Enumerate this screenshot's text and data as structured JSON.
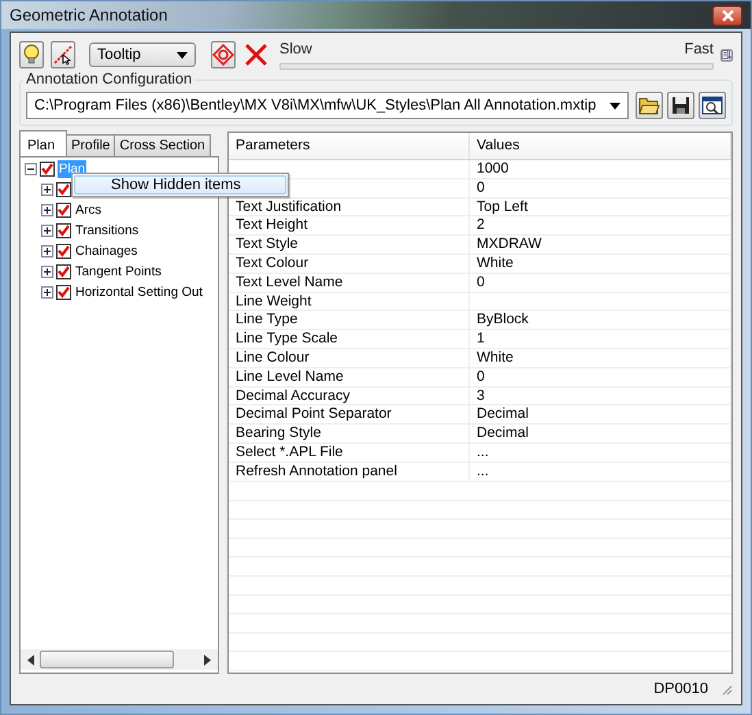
{
  "window": {
    "title": "Geometric Annotation"
  },
  "toolbar": {
    "mode_dropdown": {
      "value": "Tooltip"
    },
    "speed": {
      "min_label": "Slow",
      "max_label": "Fast"
    }
  },
  "configuration": {
    "label": "Annotation Configuration",
    "file": "C:\\Program Files (x86)\\Bentley\\MX V8i\\MX\\mfw\\UK_Styles\\Plan All Annotation.mxtip"
  },
  "tabs": [
    {
      "label": "Plan",
      "selected": true
    },
    {
      "label": "Profile",
      "selected": false
    },
    {
      "label": "Cross Section",
      "selected": false
    }
  ],
  "tree": [
    {
      "label": "Plan",
      "checked": true,
      "expanded": true,
      "selected": true,
      "children": [
        {
          "checked": true,
          "expanded": false,
          "selected": false
        },
        {
          "label": "Arcs",
          "checked": true,
          "expanded": false,
          "selected": false
        },
        {
          "label": "Transitions",
          "checked": true,
          "expanded": false,
          "selected": false
        },
        {
          "label": "Chainages",
          "checked": true,
          "expanded": false,
          "selected": false
        },
        {
          "label": "Tangent Points",
          "checked": true,
          "expanded": false,
          "selected": false
        },
        {
          "label": "Horizontal Setting Out",
          "checked": true,
          "expanded": false,
          "selected": false
        }
      ]
    }
  ],
  "context_menu": {
    "items": [
      "Show Hidden items"
    ]
  },
  "table": {
    "columns": [
      "Parameters",
      "Values"
    ],
    "rows": [
      {
        "value": "1000"
      },
      {
        "value": "0"
      },
      {
        "parameter": "Text Justification",
        "value": "Top Left"
      },
      {
        "parameter": "Text Height",
        "value": "2"
      },
      {
        "parameter": "Text Style",
        "value": "MXDRAW"
      },
      {
        "parameter": "Text Colour",
        "value": "White"
      },
      {
        "parameter": "Text Level Name",
        "value": "0"
      },
      {
        "parameter": "Line Weight"
      },
      {
        "parameter": "Line Type",
        "value": "ByBlock"
      },
      {
        "parameter": "Line Type Scale",
        "value": "1"
      },
      {
        "parameter": "Line Colour",
        "value": "White"
      },
      {
        "parameter": "Line Level Name",
        "value": "0"
      },
      {
        "parameter": "Decimal Accuracy",
        "value": "3"
      },
      {
        "parameter": "Decimal Point Separator",
        "value": "Decimal"
      },
      {
        "parameter": "Bearing Style",
        "value": "Decimal"
      },
      {
        "parameter": "Select *.APL File",
        "value": "..."
      },
      {
        "parameter": "Refresh Annotation panel",
        "value": "..."
      }
    ]
  },
  "status_bar": {
    "code": "DP0010"
  }
}
